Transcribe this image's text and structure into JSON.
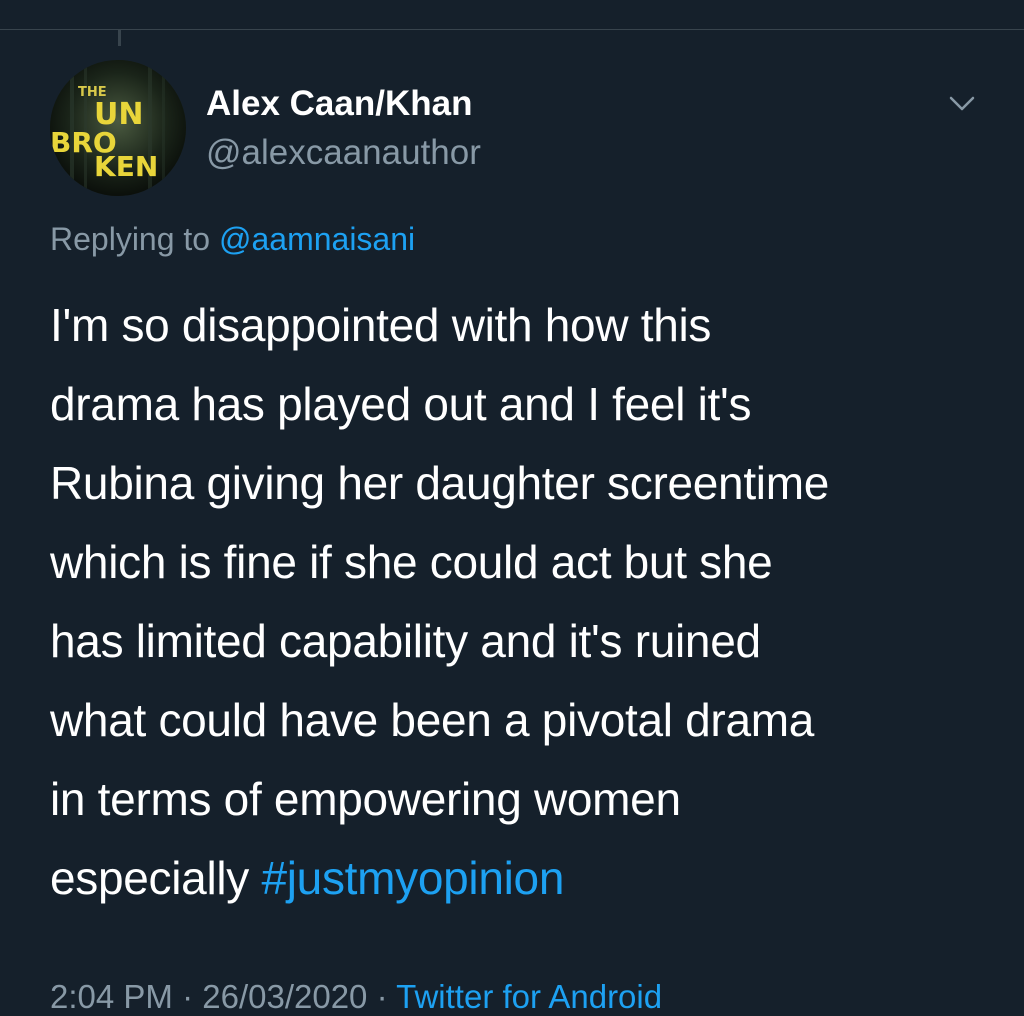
{
  "tweet": {
    "author": {
      "display_name": "Alex Caan/Khan",
      "handle": "@alexcaanauthor",
      "avatar": {
        "icon": "book-cover-avatar",
        "lettering": "THE UN BRO KEN"
      }
    },
    "replying_to": {
      "prefix": "Replying to",
      "mention": "@aamnaisani"
    },
    "body_lines": [
      "I'm so disappointed with how this",
      "drama has played out and I feel it's",
      "Rubina giving her daughter screentime",
      "which is fine if she could act but she",
      "has limited capability and it's ruined",
      "what could have been a pivotal drama",
      "in terms of empowering women",
      "especially "
    ],
    "hashtag": "#justmyopinion",
    "meta": {
      "time": "2:04 PM",
      "separator": " · ",
      "date": "26/03/2020",
      "source": "Twitter for Android"
    },
    "menu_icon": "chevron-down-icon"
  },
  "colors": {
    "background": "#15202b",
    "text": "#ffffff",
    "secondary_text": "#8899a6",
    "accent": "#1da1f2",
    "divider": "#38444d"
  }
}
